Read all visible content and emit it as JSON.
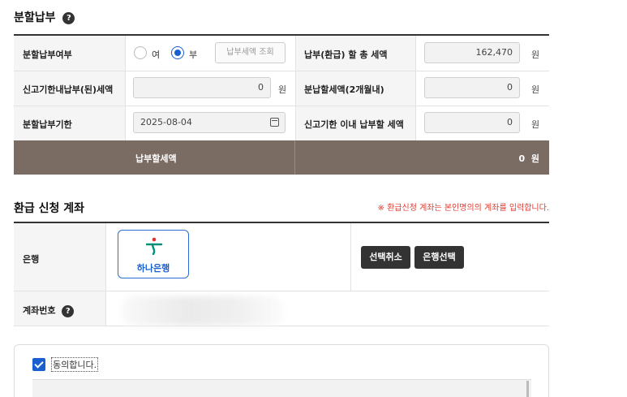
{
  "installment": {
    "title": "분할납부",
    "help": "?",
    "rows": [
      {
        "label": "분할납부여부",
        "radio_yes": "여",
        "radio_no": "부",
        "selected": "부",
        "inquiry_button": "납부세액 조회",
        "right_label": "납부(환급) 할 총 세액",
        "right_value": "162,470",
        "right_unit": "원"
      },
      {
        "label": "신고기한내납부(된)세액",
        "value": "0",
        "unit": "원",
        "right_label": "분납할세액(2개월내)",
        "right_value": "0",
        "right_unit": "원"
      },
      {
        "label": "분할납부기한",
        "date": "2025-08-04",
        "date_icon": "calendar-icon",
        "right_label": "신고기한 이내 납부할 세액",
        "right_value": "0",
        "right_unit": "원"
      }
    ],
    "total": {
      "label": "납부할세액",
      "value": "0",
      "unit": "원"
    }
  },
  "refund": {
    "title": "환급 신청 계좌",
    "notice": "※ 환급신청 계좌는 본인명의의 계좌를 입력합니다.",
    "bank_label": "은행",
    "bank_name": "하나은행",
    "cancel_button": "선택취소",
    "select_button": "은행선택",
    "account_label": "계좌번호",
    "help": "?"
  },
  "agreement": {
    "label": "동의합니다.",
    "checked": true
  },
  "colors": {
    "accent": "#1a5fd0",
    "total_bar": "#7a6b63",
    "notice": "#e03a2f",
    "dark_button": "#333333"
  }
}
